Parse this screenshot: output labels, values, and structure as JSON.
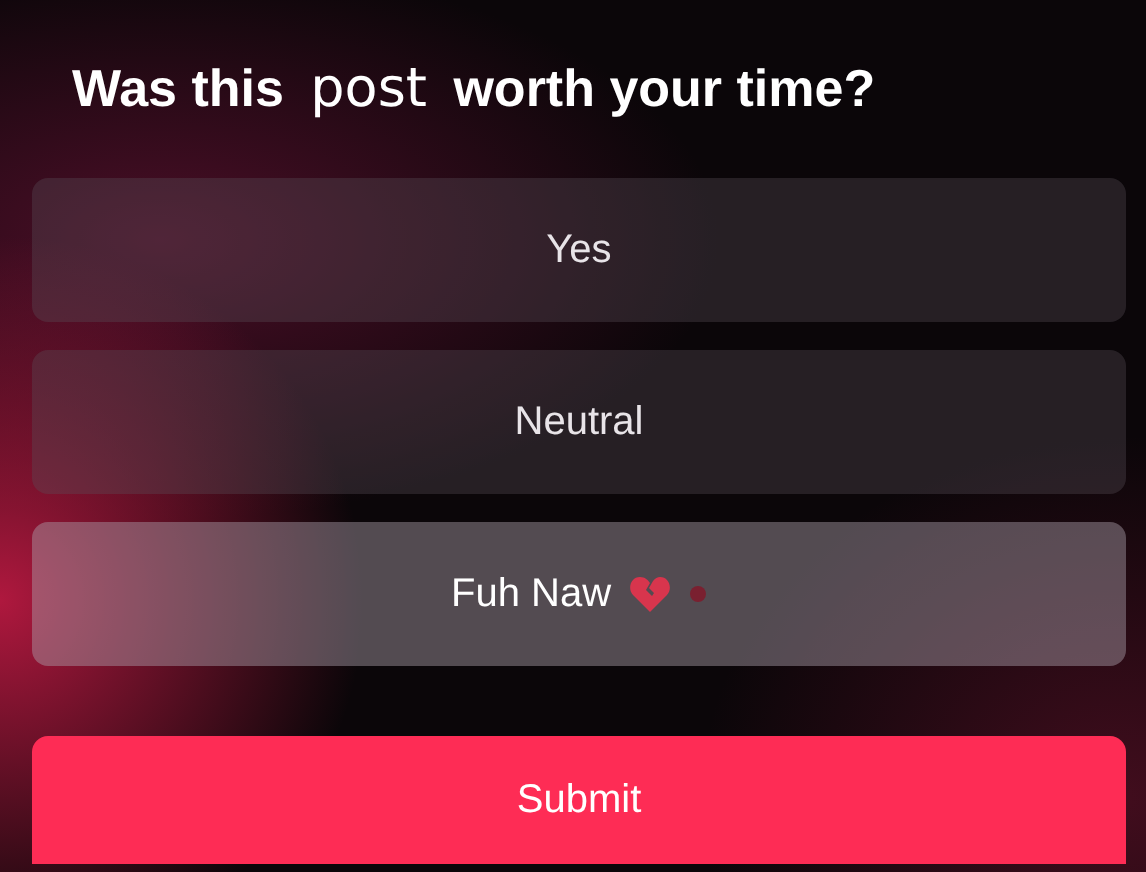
{
  "title_parts": [
    {
      "text": "Was this ",
      "kind": "bold"
    },
    {
      "text": "post",
      "kind": "plain"
    },
    {
      "text": " worth your time?",
      "kind": "bold"
    }
  ],
  "options": [
    {
      "label": "Yes",
      "selected": false,
      "kind": "text"
    },
    {
      "label": "Neutral",
      "selected": false,
      "kind": "text"
    },
    {
      "label": "Fuh Naw",
      "selected": true,
      "kind": "reaction"
    }
  ],
  "submit": {
    "label": "Submit"
  }
}
